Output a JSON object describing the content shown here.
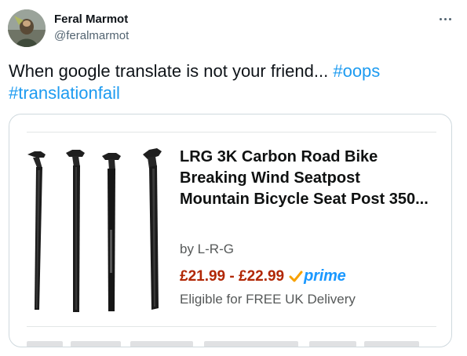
{
  "author": {
    "display_name": "Feral Marmot",
    "handle": "@feralmarmot"
  },
  "menu_icon": "more-horizontal-icon",
  "tweet": {
    "text": "When google translate is not your friend... ",
    "hashtags": [
      "#oops",
      "#translationfail"
    ]
  },
  "product": {
    "title": "LRG 3K Carbon Road Bike Breaking Wind Seatpost Mountain Bicycle Seat Post 350...",
    "brand": "by L-R-G",
    "price": "£21.99 - £22.99",
    "prime_label": "prime",
    "delivery": "Eligible for FREE UK Delivery"
  },
  "colors": {
    "link": "#1d9bf0",
    "price": "#b12704",
    "prime": "#1a98ff",
    "text": "#0f1419",
    "muted": "#536471"
  }
}
